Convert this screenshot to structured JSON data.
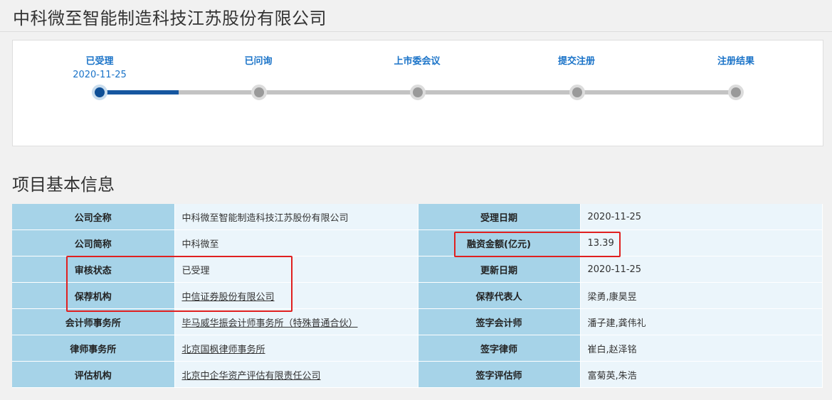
{
  "company_title": "中科微至智能制造科技江苏股份有限公司",
  "progress": {
    "steps": [
      {
        "label": "已受理",
        "date": "2020-11-25"
      },
      {
        "label": "已问询",
        "date": ""
      },
      {
        "label": "上市委会议",
        "date": ""
      },
      {
        "label": "提交注册",
        "date": ""
      },
      {
        "label": "注册结果",
        "date": ""
      }
    ],
    "current_step": 1
  },
  "section_title": "项目基本信息",
  "info": {
    "rows": [
      {
        "k1": "公司全称",
        "v1": "中科微至智能制造科技江苏股份有限公司",
        "k2": "受理日期",
        "v2": "2020-11-25"
      },
      {
        "k1": "公司简称",
        "v1": "中科微至",
        "k2": "融资金额(亿元)",
        "v2": "13.39"
      },
      {
        "k1": "审核状态",
        "v1": "已受理",
        "k2": "更新日期",
        "v2": "2020-11-25"
      },
      {
        "k1": "保荐机构",
        "v1": "中信证券股份有限公司",
        "k2": "保荐代表人",
        "v2": "梁勇,康昊昱"
      },
      {
        "k1": "会计师事务所",
        "v1": "毕马威华振会计师事务所（特殊普通合伙）",
        "k2": "签字会计师",
        "v2": "潘子建,龚伟礼"
      },
      {
        "k1": "律师事务所",
        "v1": "北京国枫律师事务所",
        "k2": "签字律师",
        "v2": "崔白,赵泽铭"
      },
      {
        "k1": "评估机构",
        "v1": "北京中企华资产评估有限责任公司",
        "k2": "签字评估师",
        "v2": "富菊英,朱浩"
      }
    ]
  },
  "colors": {
    "accent_blue": "#1a73c8",
    "progress_fill": "#1657a0",
    "key_cell": "#a6d3e8",
    "value_cell": "#ebf5fb",
    "highlight_red": "#e02020"
  }
}
